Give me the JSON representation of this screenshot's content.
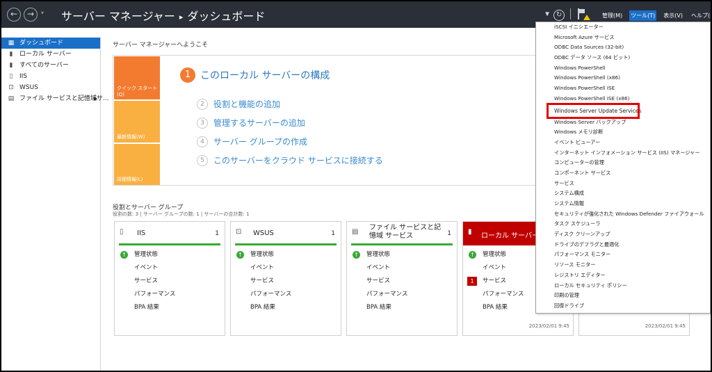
{
  "header": {
    "title": "サーバー マネージャー",
    "title_sep": "▸",
    "title_page": "ダッシュボード",
    "back_glyph": "←",
    "forward_glyph": "→",
    "dropdown_glyph": "▾",
    "menus": [
      "管理(M)",
      "ツール(T)",
      "表示(V)",
      "ヘルプ(H)"
    ],
    "active_menu": "ツール(T)"
  },
  "sidebar": {
    "items": [
      {
        "label": "ダッシュボード",
        "icon": "dashboard-icon",
        "selected": true
      },
      {
        "label": "ローカル サーバー",
        "icon": "server-icon"
      },
      {
        "label": "すべてのサーバー",
        "icon": "servers-icon"
      },
      {
        "label": "IIS",
        "icon": "iis-icon"
      },
      {
        "label": "WSUS",
        "icon": "wsus-icon"
      },
      {
        "label": "ファイル サービスと記憶域サ...",
        "icon": "file-services-icon",
        "arrow": "▶"
      }
    ]
  },
  "main": {
    "welcome": "サーバー マネージャーへようこそ",
    "tiles": [
      "クイック スタート(Q)",
      "最新情報(W)",
      "詳細情報(L)"
    ],
    "steps": [
      {
        "num": "1",
        "label": "このローカル サーバーの構成"
      },
      {
        "num": "2",
        "label": "役割と機能の追加"
      },
      {
        "num": "3",
        "label": "管理するサーバーの追加"
      },
      {
        "num": "4",
        "label": "サーバー グループの作成"
      },
      {
        "num": "5",
        "label": "このサーバーをクラウド サービスに接続する"
      }
    ],
    "roles_title": "役割とサーバー グループ",
    "roles_counts": "役割の数: 3  |  サーバー グループの数: 1  |  サーバーの合計数: 1",
    "cards": [
      {
        "title": "IIS",
        "count": "1",
        "rows": [
          "管理状態",
          "イベント",
          "サービス",
          "パフォーマンス",
          "BPA 結果"
        ]
      },
      {
        "title": "WSUS",
        "count": "1",
        "rows": [
          "管理状態",
          "イベント",
          "サービス",
          "パフォーマンス",
          "BPA 結果"
        ]
      },
      {
        "title": "ファイル サービスと記憶域 サービス",
        "count": "1",
        "rows": [
          "管理状態",
          "イベント",
          "サービス",
          "パフォーマンス",
          "BPA 結果"
        ]
      },
      {
        "title": "ローカル サーバー",
        "badge": "1",
        "rows": [
          "管理状態",
          "イベント",
          "サービス",
          "パフォーマンス",
          "BPA 結果"
        ],
        "time": "2023/02/01 9:45"
      },
      {
        "time": "2023/02/01 9:45"
      }
    ]
  },
  "tools_menu": {
    "items": [
      "iSCSI イニシエーター",
      "Microsoft Azure サービス",
      "ODBC Data Sources (32-bit)",
      "ODBC データ ソース (64 ビット)",
      "Windows PowerShell",
      "Windows PowerShell (x86)",
      "Windows PowerShell ISE",
      "Windows PowerShell ISE (x86)",
      "Windows Server Update Services",
      "Windows Server バックアップ",
      "Windows メモリ診断",
      "イベント ビューアー",
      "インターネット インフォメーション サービス (IIS) マネージャー",
      "コンピューターの管理",
      "コンポーネント サービス",
      "サービス",
      "システム構成",
      "システム情報",
      "セキュリティが強化された Windows Defender ファイアウォール",
      "タスク スケジューラ",
      "ディスク クリーンアップ",
      "ドライブのデフラグと最適化",
      "パフォーマンス モニター",
      "リソース モニター",
      "レジストリ エディター",
      "ローカル セキュリティ ポリシー",
      "印刷の管理",
      "回復ドライブ"
    ],
    "highlighted": "Windows Server Update Services"
  },
  "colors": {
    "header_bg": "#2a2f38",
    "accent": "#1a6fc9",
    "orange": "#f37b30",
    "amber": "#f9b041",
    "ok_green": "#3aa935",
    "alert_red": "#c00000",
    "highlight_box": "#e40000"
  }
}
